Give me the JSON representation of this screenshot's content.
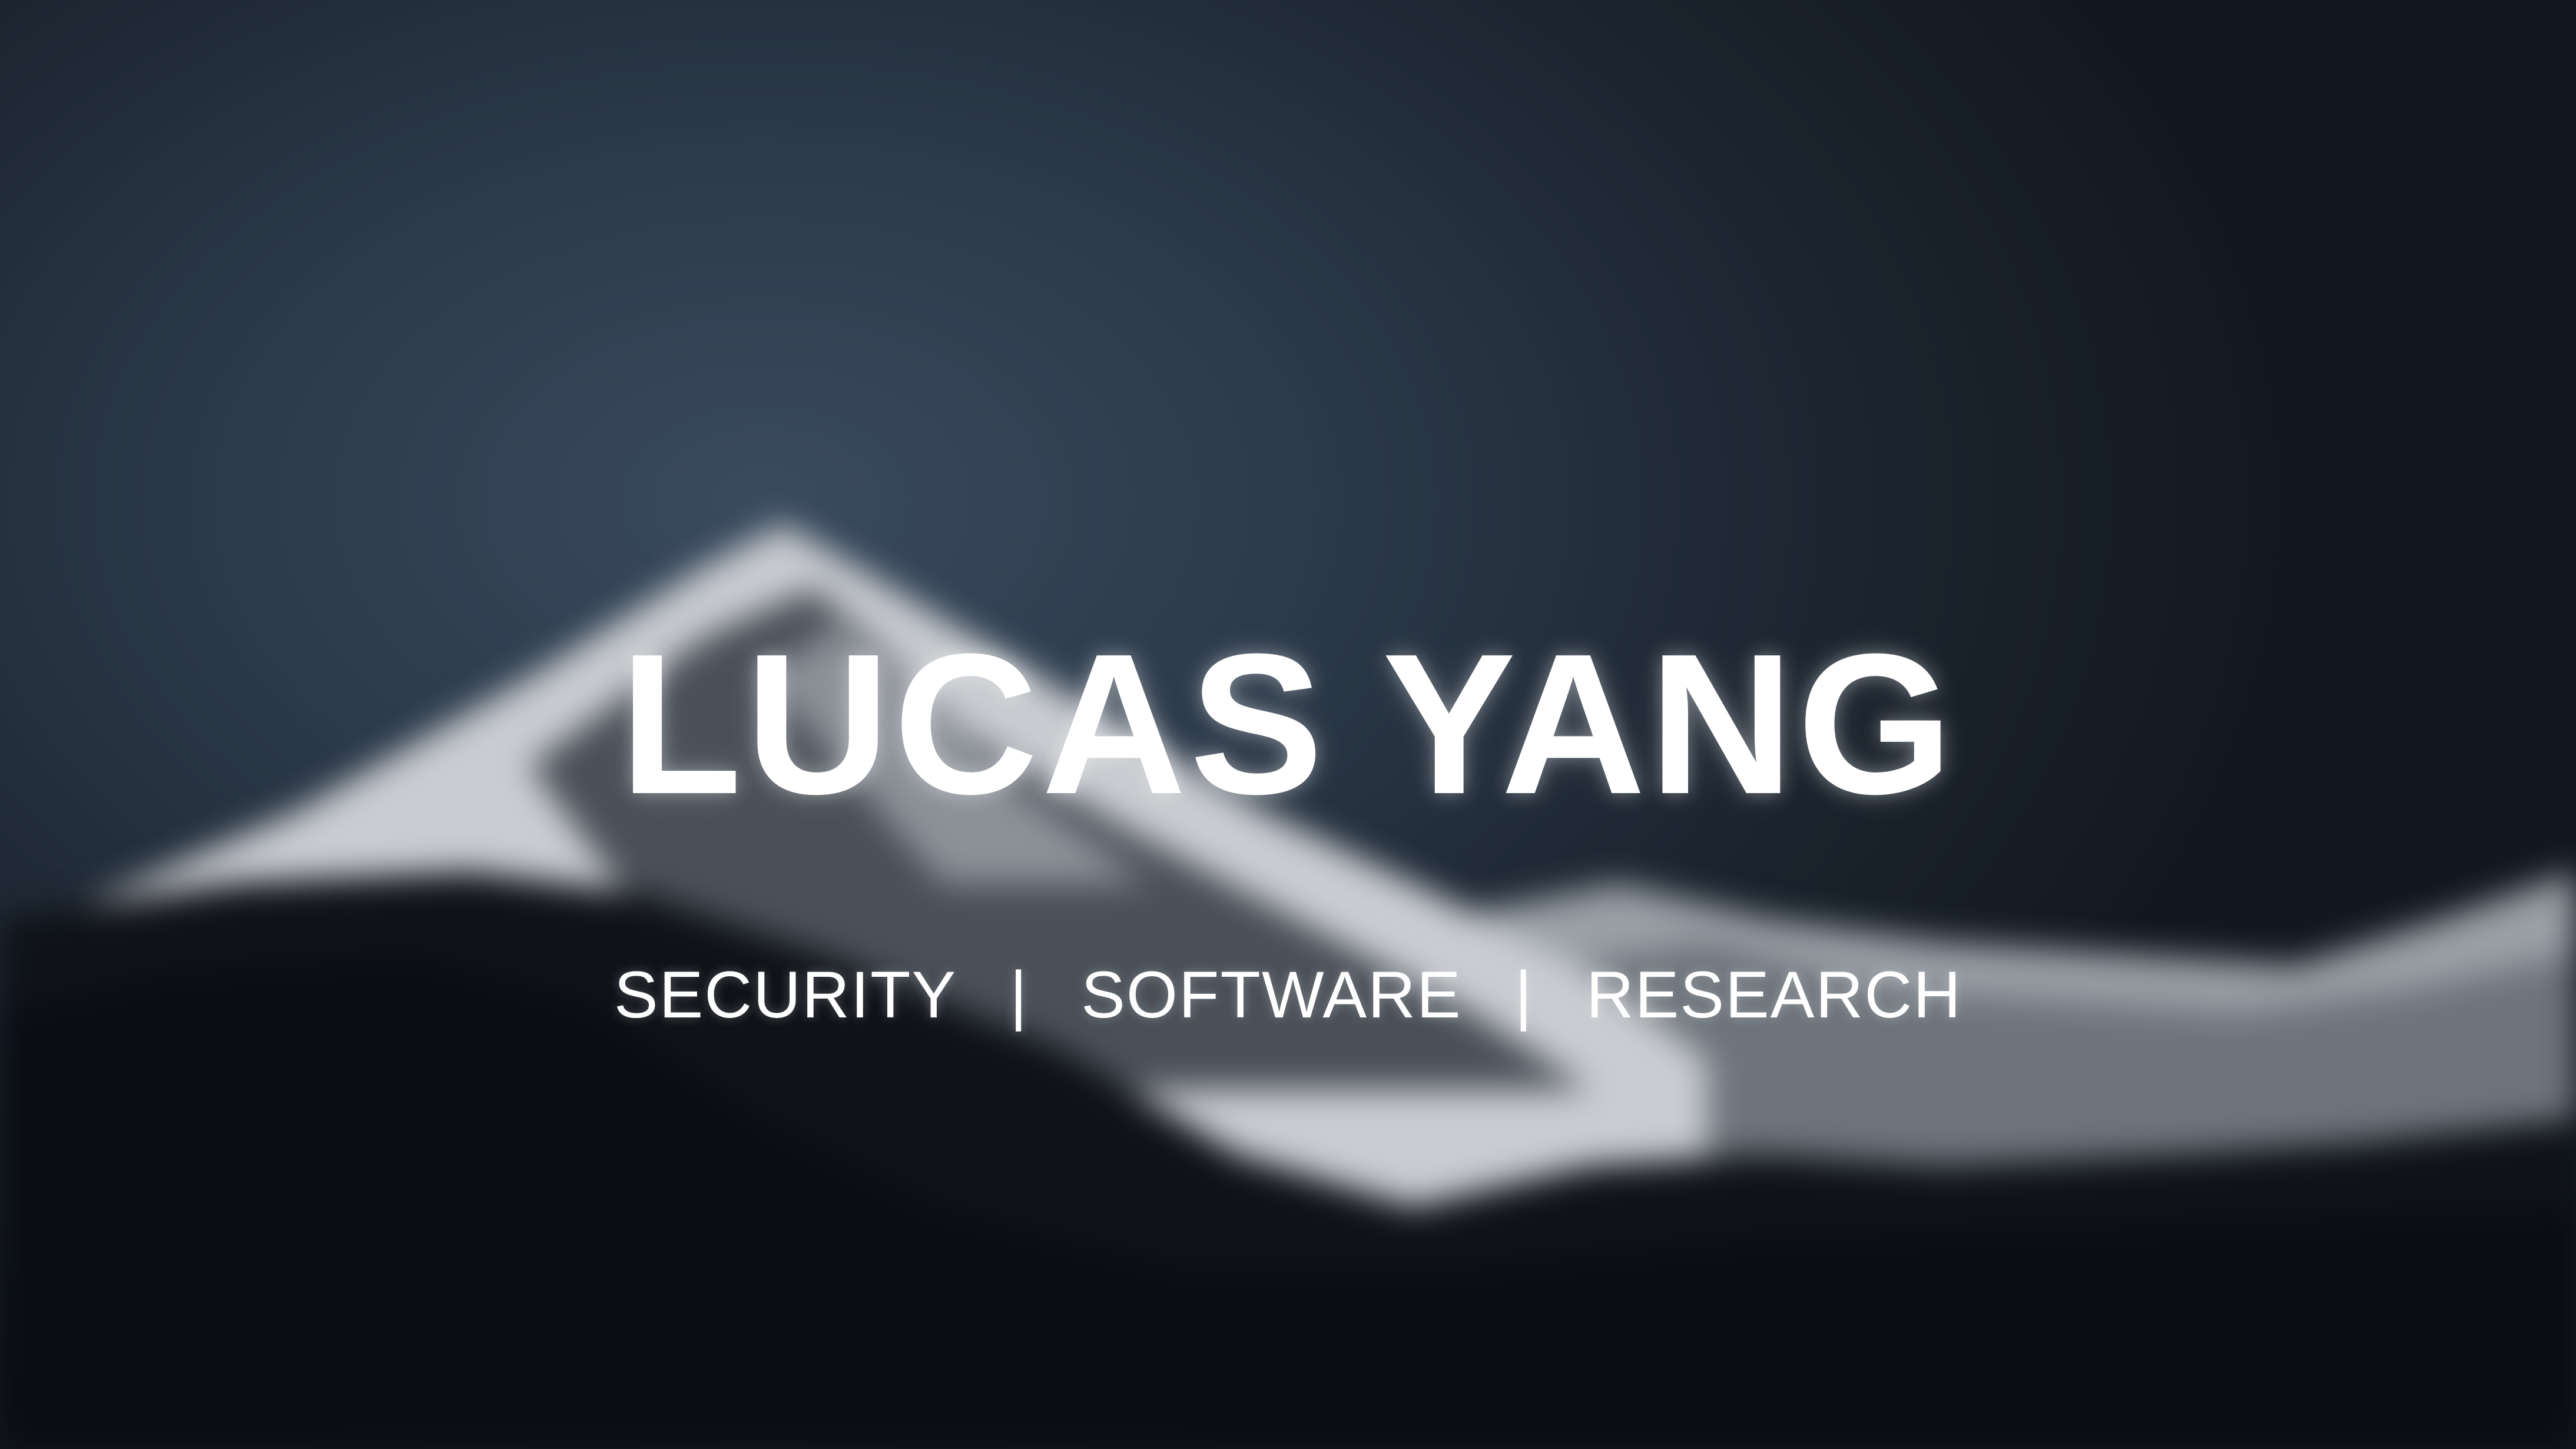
{
  "hero": {
    "name": "LUCAS YANG",
    "tagline": [
      "SECURITY",
      "SOFTWARE",
      "RESEARCH"
    ],
    "separator": "|",
    "background_image": "blurred-snowy-mountain-peak"
  },
  "colors": {
    "sky_light": "#3a4b5e",
    "sky_dark": "#12181f",
    "foreground_dark": "#0d1116",
    "text": "#ffffff"
  }
}
